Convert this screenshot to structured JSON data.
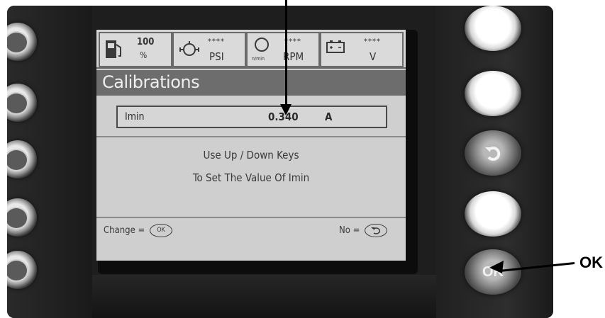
{
  "status": {
    "fuel": {
      "value": "100",
      "unit": "%"
    },
    "oil_pressure": {
      "value": "****",
      "unit": "PSI"
    },
    "engine_speed": {
      "value": "****",
      "unit": "RPM",
      "sub_unit": "n/min"
    },
    "battery": {
      "value": "****",
      "unit": "V"
    }
  },
  "screen": {
    "title": "Calibrations",
    "parameter": {
      "name": "Imin",
      "value": "0.340",
      "unit": "A"
    },
    "instruction_line1": "Use Up / Down Keys",
    "instruction_line2": "To Set The Value Of Imin"
  },
  "footer": {
    "change_label": "Change =",
    "change_key": "OK",
    "no_label": "No ="
  },
  "buttons": {
    "ok_label": "OK"
  },
  "annotation": {
    "ok_callout": "OK"
  },
  "icons": [
    "fuel-pump-icon",
    "oil-can-icon",
    "engine-icon",
    "battery-icon",
    "back-arrow-icon"
  ]
}
